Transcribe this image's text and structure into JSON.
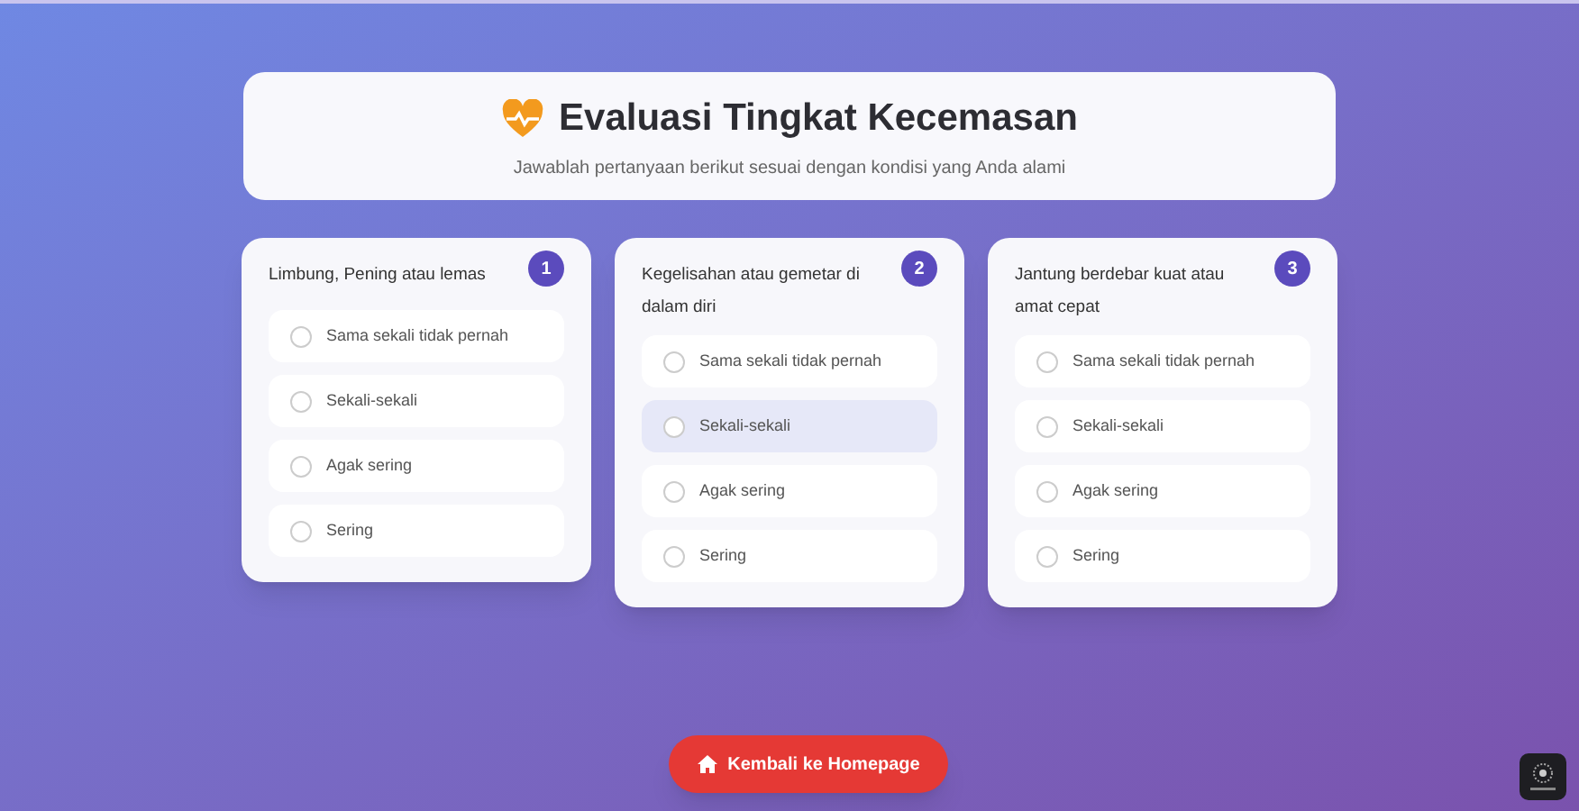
{
  "header": {
    "title": "Evaluasi Tingkat Kecemasan",
    "subtitle": "Jawablah pertanyaan berikut sesuai dengan kondisi yang Anda alami"
  },
  "questions": [
    {
      "number": "1",
      "text": "Limbung, Pening atau lemas",
      "options": [
        {
          "label": "Sama sekali tidak pernah",
          "selected": false,
          "highlighted": false
        },
        {
          "label": "Sekali-sekali",
          "selected": false,
          "highlighted": false
        },
        {
          "label": "Agak sering",
          "selected": false,
          "highlighted": false
        },
        {
          "label": "Sering",
          "selected": false,
          "highlighted": false
        }
      ]
    },
    {
      "number": "2",
      "text": "Kegelisahan atau gemetar di dalam diri",
      "options": [
        {
          "label": "Sama sekali tidak pernah",
          "selected": false,
          "highlighted": false
        },
        {
          "label": "Sekali-sekali",
          "selected": false,
          "highlighted": true
        },
        {
          "label": "Agak sering",
          "selected": false,
          "highlighted": false
        },
        {
          "label": "Sering",
          "selected": false,
          "highlighted": false
        }
      ]
    },
    {
      "number": "3",
      "text": "Jantung berdebar kuat atau amat cepat",
      "options": [
        {
          "label": "Sama sekali tidak pernah",
          "selected": false,
          "highlighted": false
        },
        {
          "label": "Sekali-sekali",
          "selected": false,
          "highlighted": false
        },
        {
          "label": "Agak sering",
          "selected": false,
          "highlighted": false
        },
        {
          "label": "Sering",
          "selected": false,
          "highlighted": false
        }
      ]
    }
  ],
  "home_button": {
    "label": "Kembali ke Homepage"
  }
}
